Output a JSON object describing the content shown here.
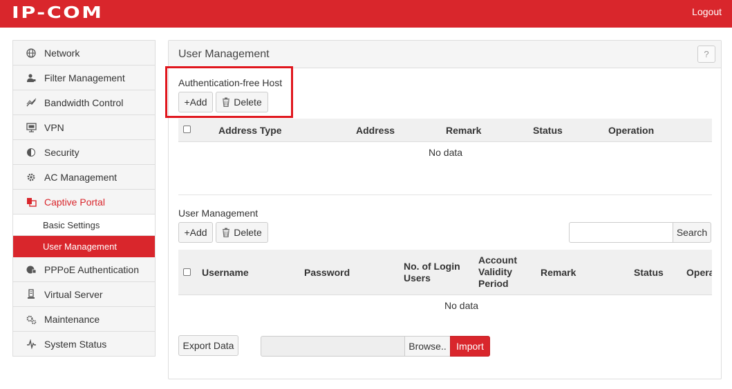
{
  "header": {
    "logo": "IP-COM",
    "logout": "Logout",
    "brand_color": "#d9262c"
  },
  "sidebar": {
    "items": [
      {
        "label": "Network",
        "icon": "globe-icon"
      },
      {
        "label": "Filter Management",
        "icon": "user-filter-icon"
      },
      {
        "label": "Bandwidth Control",
        "icon": "chart-line-icon"
      },
      {
        "label": "VPN",
        "icon": "monitor-icon"
      },
      {
        "label": "Security",
        "icon": "shield-icon"
      },
      {
        "label": "AC Management",
        "icon": "gear-icon"
      },
      {
        "label": "Captive Portal",
        "icon": "portal-icon",
        "active": true
      },
      {
        "label": "PPPoE Authentication",
        "icon": "globe-lock-icon"
      },
      {
        "label": "Virtual Server",
        "icon": "server-icon"
      },
      {
        "label": "Maintenance",
        "icon": "gears-icon"
      },
      {
        "label": "System Status",
        "icon": "pulse-icon"
      }
    ],
    "sub_items": [
      {
        "label": "Basic Settings"
      },
      {
        "label": "User Management",
        "active": true
      }
    ]
  },
  "main": {
    "title": "User Management",
    "help": "?",
    "auth_free": {
      "label": "Authentication-free Host",
      "add": "+Add",
      "delete": "Delete",
      "columns": [
        "Address Type",
        "Address",
        "Remark",
        "Status",
        "Operation"
      ],
      "empty": "No data"
    },
    "users": {
      "label": "User Management",
      "add": "+Add",
      "delete": "Delete",
      "search_placeholder": "",
      "search": "Search",
      "columns": [
        "Username",
        "Password",
        "No. of Login Users",
        "Account Validity Period",
        "Remark",
        "Status",
        "Opera"
      ],
      "empty": "No data"
    },
    "footer": {
      "export": "Export Data",
      "browse": "Browse..",
      "import": "Import"
    }
  }
}
